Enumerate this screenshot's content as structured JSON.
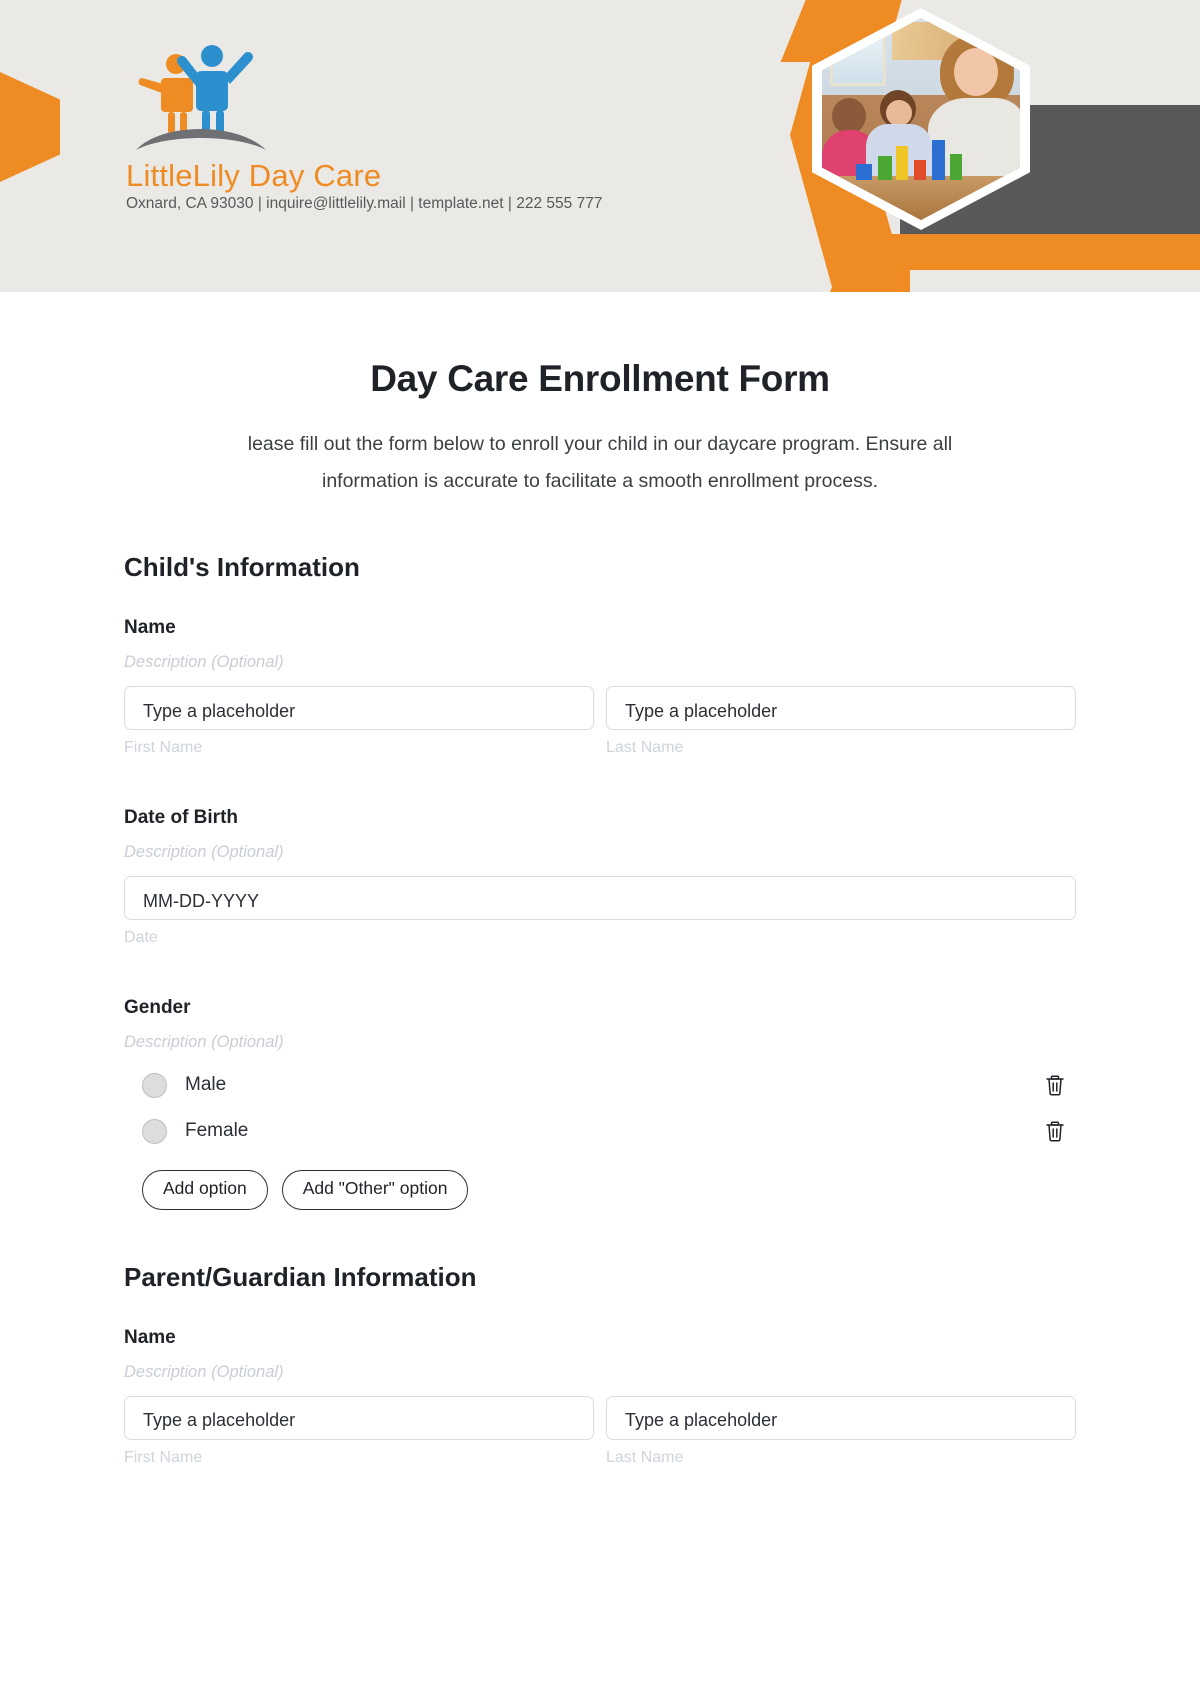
{
  "brand": {
    "name": "LittleLily Day Care",
    "contact": "Oxnard, CA 93030 | inquire@littlelily.mail | template.net | 222 555 777",
    "accent_color": "#ee8c23",
    "logo_icon": "two-children-logo-icon",
    "photo_icon": "daycare-classroom-photo"
  },
  "form": {
    "title": "Day Care Enrollment Form",
    "description": "lease fill out the form below to enroll your child in our daycare program. Ensure all information is accurate to facilitate a smooth enrollment process."
  },
  "sections": [
    {
      "title": "Child's Information",
      "fields": [
        {
          "label": "Name",
          "description": "Description (Optional)",
          "type": "name",
          "inputs": [
            {
              "value": "Type a placeholder",
              "placeholder": "Type a placeholder",
              "sub_label": "First Name"
            },
            {
              "value": "Type a placeholder",
              "placeholder": "Type a placeholder",
              "sub_label": "Last Name"
            }
          ]
        },
        {
          "label": "Date of Birth",
          "description": "Description (Optional)",
          "type": "date",
          "inputs": [
            {
              "value": "MM-DD-YYYY",
              "placeholder": "MM-DD-YYYY",
              "sub_label": "Date"
            }
          ]
        },
        {
          "label": "Gender",
          "description": "Description (Optional)",
          "type": "radio",
          "options": [
            {
              "label": "Male",
              "selected": false,
              "delete_icon": "trash-icon"
            },
            {
              "label": "Female",
              "selected": false,
              "delete_icon": "trash-icon"
            }
          ],
          "buttons": [
            {
              "label": "Add option"
            },
            {
              "label": "Add \"Other\" option"
            }
          ]
        }
      ]
    },
    {
      "title": "Parent/Guardian Information",
      "fields": [
        {
          "label": "Name",
          "description": "Description (Optional)",
          "type": "name",
          "inputs": [
            {
              "value": "Type a placeholder",
              "placeholder": "Type a placeholder",
              "sub_label": "First Name"
            },
            {
              "value": "Type a placeholder",
              "placeholder": "Type a placeholder",
              "sub_label": "Last Name"
            }
          ]
        }
      ]
    }
  ]
}
